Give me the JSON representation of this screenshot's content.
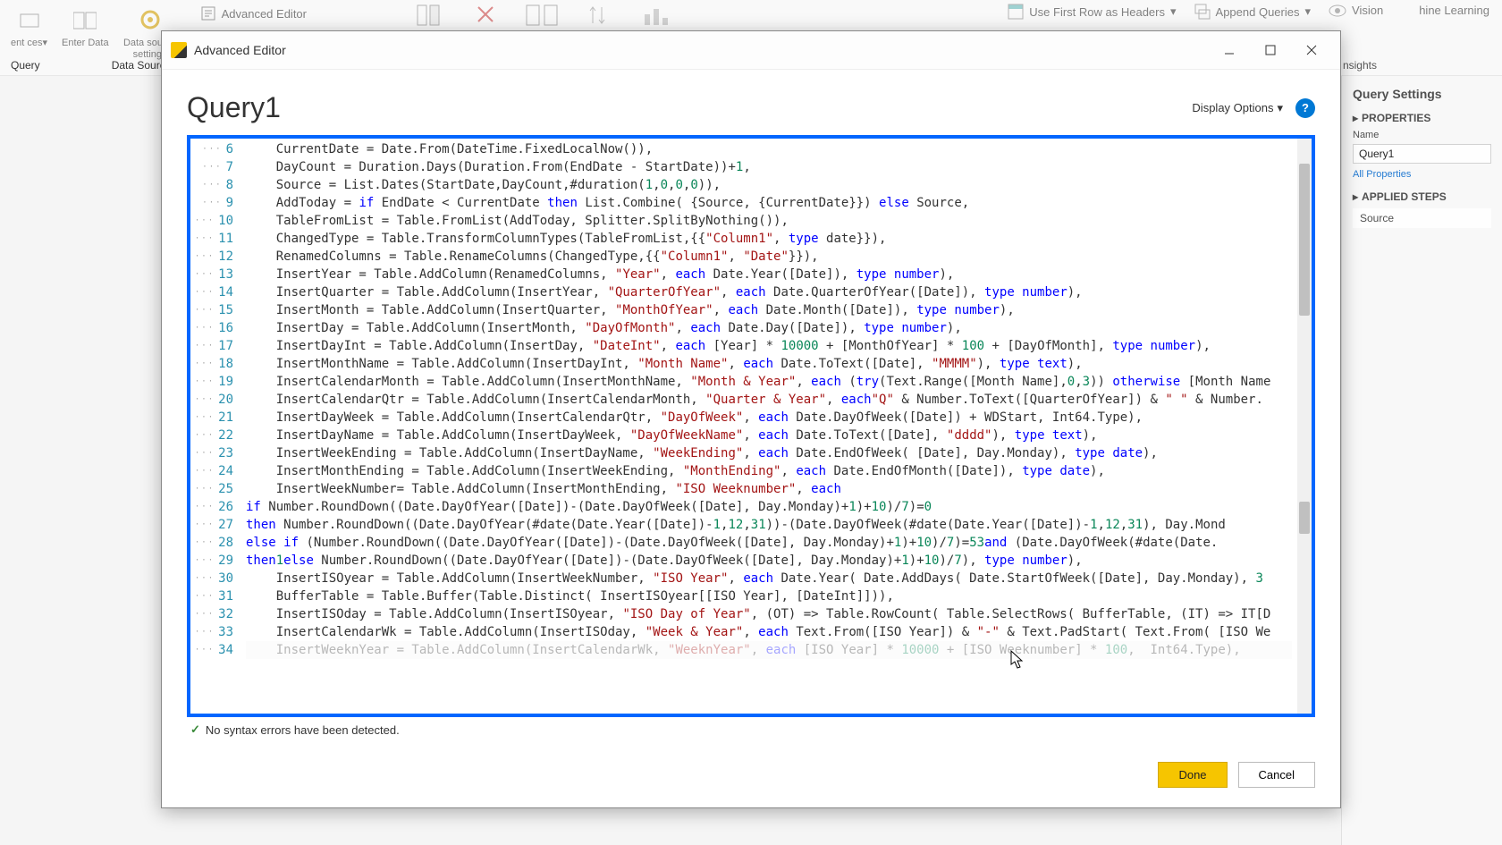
{
  "ribbon": {
    "buttons": {
      "recent": "ent\nces",
      "enter_data": "Enter\nData",
      "data_source_settings": "Data source\nsettings",
      "advanced_editor": "Advanced Editor",
      "use_first_row": "Use First Row as Headers",
      "append_queries": "Append Queries",
      "vision": "Vision",
      "machine_learning": "hine Learning"
    },
    "tabs": {
      "query": "Query",
      "data_sour": "Data Sourc",
      "insights": "nsights"
    }
  },
  "right_panel": {
    "title": "Query Settings",
    "properties": "PROPERTIES",
    "name_label": "Name",
    "name_value": "Query1",
    "all_props": "All Properties",
    "applied_steps": "APPLIED STEPS",
    "step_source": "Source"
  },
  "modal": {
    "window_title": "Advanced Editor",
    "query_name": "Query1",
    "display_options": "Display Options",
    "status": "No syntax errors have been detected.",
    "done": "Done",
    "cancel": "Cancel",
    "help": "?"
  },
  "code_lines": [
    {
      "n": 6,
      "t": "    CurrentDate = Date.From(DateTime.FixedLocalNow()),"
    },
    {
      "n": 7,
      "t": "    DayCount = Duration.Days(Duration.From(EndDate - StartDate))+<n>1</n>,"
    },
    {
      "n": 8,
      "t": "    Source = List.Dates(StartDate,DayCount,#duration(<n>1</n>,<n>0</n>,<n>0</n>,<n>0</n>)),"
    },
    {
      "n": 9,
      "t": "    AddToday = <k>if</k> EndDate < CurrentDate <k>then</k> List.Combine( {Source, {CurrentDate}}) <k>else</k> Source,"
    },
    {
      "n": 10,
      "t": "    TableFromList = Table.FromList(AddToday, Splitter.SplitByNothing()),"
    },
    {
      "n": 11,
      "t": "    ChangedType = Table.TransformColumnTypes(TableFromList,{{<s>\"Column1\"</s>, <k>type</k> date}}),"
    },
    {
      "n": 12,
      "t": "    RenamedColumns = Table.RenameColumns(ChangedType,{{<s>\"Column1\"</s>, <s>\"Date\"</s>}}),"
    },
    {
      "n": 13,
      "t": "    InsertYear = Table.AddColumn(RenamedColumns, <s>\"Year\"</s>, <k>each</k> Date.Year([Date]), <k>type number</k>),"
    },
    {
      "n": 14,
      "t": "    InsertQuarter = Table.AddColumn(InsertYear, <s>\"QuarterOfYear\"</s>, <k>each</k> Date.QuarterOfYear([Date]), <k>type number</k>),"
    },
    {
      "n": 15,
      "t": "    InsertMonth = Table.AddColumn(InsertQuarter, <s>\"MonthOfYear\"</s>, <k>each</k> Date.Month([Date]), <k>type number</k>),"
    },
    {
      "n": 16,
      "t": "    InsertDay = Table.AddColumn(InsertMonth, <s>\"DayOfMonth\"</s>, <k>each</k> Date.Day([Date]), <k>type number</k>),"
    },
    {
      "n": 17,
      "t": "    InsertDayInt = Table.AddColumn(InsertDay, <s>\"DateInt\"</s>, <k>each</k> [Year] * <n>10000</n> + [MonthOfYear] * <n>100</n> + [DayOfMonth], <k>type number</k>),"
    },
    {
      "n": 18,
      "t": "    InsertMonthName = Table.AddColumn(InsertDayInt, <s>\"Month Name\"</s>, <k>each</k> Date.ToText([Date], <s>\"MMMM\"</s>), <k>type text</k>),"
    },
    {
      "n": 19,
      "t": "    InsertCalendarMonth = Table.AddColumn(InsertMonthName, <s>\"Month & Year\"</s>, <k>each</k> (<k>try</k>(Text.Range([Month Name],<n>0</n>,<n>3</n>)) <k>otherwise</k> [Month Name"
    },
    {
      "n": 20,
      "t": "    InsertCalendarQtr = Table.AddColumn(InsertCalendarMonth, <s>\"Quarter & Year\"</s>, <k>each</k> <s>\"Q\"</s> & Number.ToText([QuarterOfYear]) & <s>\" \"</s> & Number."
    },
    {
      "n": 21,
      "t": "    InsertDayWeek = Table.AddColumn(InsertCalendarQtr, <s>\"DayOfWeek\"</s>, <k>each</k> Date.DayOfWeek([Date]) + WDStart, Int64.Type),"
    },
    {
      "n": 22,
      "t": "    InsertDayName = Table.AddColumn(InsertDayWeek, <s>\"DayOfWeekName\"</s>, <k>each</k> Date.ToText([Date], <s>\"dddd\"</s>), <k>type text</k>),"
    },
    {
      "n": 23,
      "t": "    InsertWeekEnding = Table.AddColumn(InsertDayName, <s>\"WeekEnding\"</s>, <k>each</k> Date.EndOfWeek( [Date], Day.Monday), <k>type date</k>),"
    },
    {
      "n": 24,
      "t": "    InsertMonthEnding = Table.AddColumn(InsertWeekEnding, <s>\"MonthEnding\"</s>, <k>each</k> Date.EndOfMonth([Date]), <k>type date</k>),"
    },
    {
      "n": 25,
      "t": "    InsertWeekNumber= Table.AddColumn(InsertMonthEnding, <s>\"ISO Weeknumber\"</s>, <k>each</k>"
    },
    {
      "n": 26,
      "t": "      <k>if</k> Number.RoundDown((Date.DayOfYear([Date])-(Date.DayOfWeek([Date], Day.Monday)+<n>1</n>)+<n>10</n>)/<n>7</n>)=<n>0</n>"
    },
    {
      "n": 27,
      "t": "      <k>then</k> Number.RoundDown((Date.DayOfYear(#date(Date.Year([Date])-<n>1</n>,<n>12</n>,<n>31</n>))-(Date.DayOfWeek(#date(Date.Year([Date])-<n>1</n>,<n>12</n>,<n>31</n>), Day.Mond"
    },
    {
      "n": 28,
      "t": "      <k>else if</k> (Number.RoundDown((Date.DayOfYear([Date])-(Date.DayOfWeek([Date], Day.Monday)+<n>1</n>)+<n>10</n>)/<n>7</n>)=<n>53</n> <k>and</k> (Date.DayOfWeek(#date(Date."
    },
    {
      "n": 29,
      "t": "      <k>then</k> <n>1</n> <k>else</k> Number.RoundDown((Date.DayOfYear([Date])-(Date.DayOfWeek([Date], Day.Monday)+<n>1</n>)+<n>10</n>)/<n>7</n>), <k>type number</k>),"
    },
    {
      "n": 30,
      "t": "    InsertISOyear = Table.AddColumn(InsertWeekNumber, <s>\"ISO Year\"</s>, <k>each</k> Date.Year( Date.AddDays( Date.StartOfWeek([Date], Day.Monday), <n>3</n>"
    },
    {
      "n": 31,
      "t": "    BufferTable = Table.Buffer(Table.Distinct( InsertISOyear[[ISO Year], [DateInt]])),"
    },
    {
      "n": 32,
      "t": "    InsertISOday = Table.AddColumn(InsertISOyear, <s>\"ISO Day of Year\"</s>, (OT) => Table.RowCount( Table.SelectRows( BufferTable, (IT) => IT[D"
    },
    {
      "n": 33,
      "t": "    InsertCalendarWk = Table.AddColumn(InsertISOday, <s>\"Week & Year\"</s>, <k>each</k> Text.From([ISO Year]) & <s>\"-\"</s> & Text.PadStart( Text.From( [ISO We"
    },
    {
      "n": 34,
      "t": "    InsertWeeknYear = Table.AddColumn(InsertCalendarWk, <s>\"WeeknYear\"</s>, <k>each</k> [ISO Year] * <n>10000</n> + [ISO Weeknumber] * <n>100</n>,  Int64.Type),",
      "dim": true
    }
  ]
}
